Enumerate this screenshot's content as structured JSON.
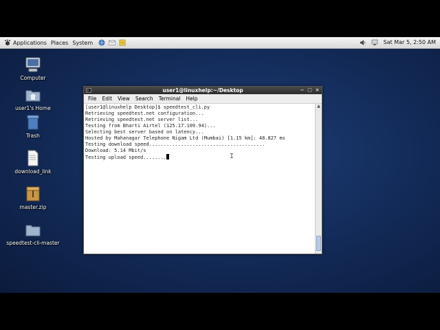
{
  "panel": {
    "menu_applications": "Applications",
    "menu_places": "Places",
    "menu_system": "System",
    "clock": "Sat Mar 5, 2:50 AM",
    "launcher_icons": [
      "browser-icon",
      "mail-icon",
      "notes-icon"
    ]
  },
  "desktop_icons": [
    {
      "name": "computer",
      "label": "Computer"
    },
    {
      "name": "home",
      "label": "user1's Home"
    },
    {
      "name": "trash",
      "label": "Trash"
    },
    {
      "name": "download-link",
      "label": "download_link"
    },
    {
      "name": "master-zip",
      "label": "master.zip"
    },
    {
      "name": "speedtest-folder",
      "label": "speedtest-cli-master"
    }
  ],
  "terminal": {
    "title": "user1@linuxhelp:~/Desktop",
    "menu": [
      "File",
      "Edit",
      "View",
      "Search",
      "Terminal",
      "Help"
    ],
    "lines": [
      "[user1@linuxhelp Desktop]$ speedtest_cli.py",
      "Retrieving speedtest.net configuration...",
      "Retrieving speedtest.net server list...",
      "Testing from Bharti Airtel (125.17.109.94)...",
      "Selecting best server based on latency...",
      "Hosted by Mahanagar Telephone Nigam Ltd (Mumbai) [1.15 km]: 48.827 ms",
      "Testing download speed........................................",
      "Download: 5.14 Mbit/s",
      "Testing upload speed........"
    ]
  },
  "colors": {
    "desktop_bg": "#142d5c",
    "panel_bg": "#e6e6e6",
    "titlebar_bg": "#333333"
  }
}
